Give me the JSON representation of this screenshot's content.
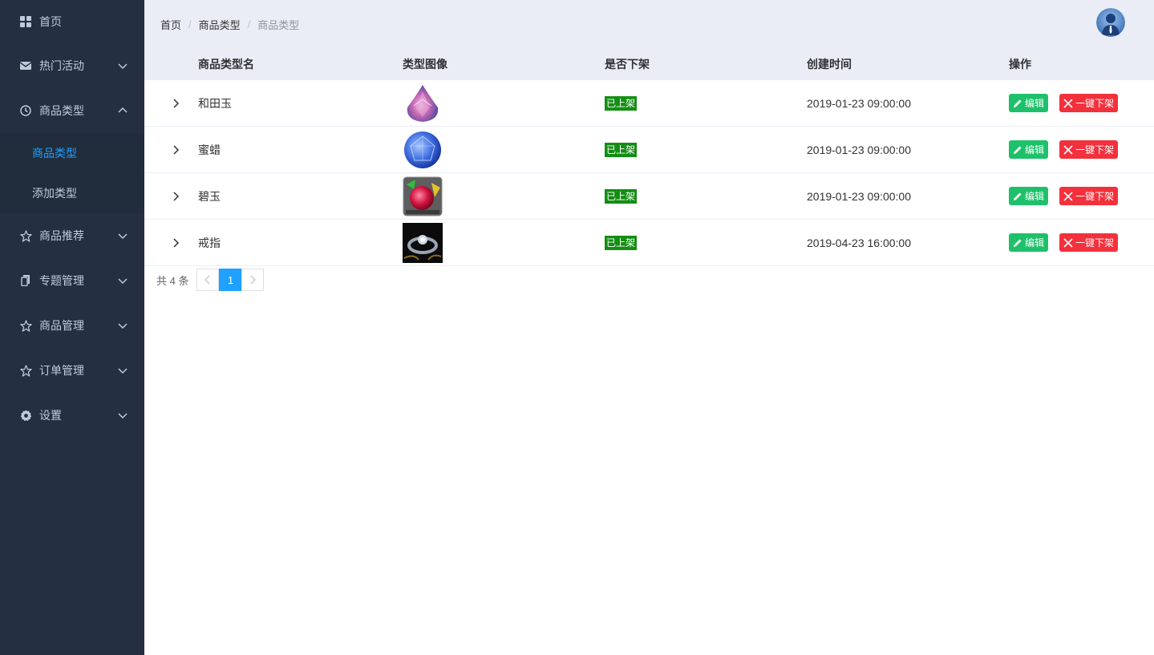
{
  "sidebar": {
    "items": [
      {
        "label": "首页",
        "icon": "grid-icon"
      },
      {
        "label": "热门活动",
        "icon": "mail-icon"
      },
      {
        "label": "商品类型",
        "icon": "clock-icon"
      },
      {
        "label": "商品推荐",
        "icon": "star-icon"
      },
      {
        "label": "专题管理",
        "icon": "document-icon"
      },
      {
        "label": "商品管理",
        "icon": "star-icon"
      },
      {
        "label": "订单管理",
        "icon": "star-icon"
      },
      {
        "label": "设置",
        "icon": "gear-icon"
      }
    ],
    "submenu": [
      {
        "label": "商品类型"
      },
      {
        "label": "添加类型"
      }
    ],
    "active_color": "#20a0ff",
    "bg_color": "#242f42"
  },
  "breadcrumb": [
    "首页",
    "商品类型",
    "商品类型"
  ],
  "table": {
    "headers": {
      "name": "商品类型名",
      "image": "类型图像",
      "status": "是否下架",
      "created": "创建时间",
      "ops": "操作"
    },
    "rows": [
      {
        "name": "和田玉",
        "status": "已上架",
        "created": "2019-01-23 09:00:00",
        "image": "pink-gem"
      },
      {
        "name": "蜜蜡",
        "status": "已上架",
        "created": "2019-01-23 09:00:00",
        "image": "blue-gem"
      },
      {
        "name": "碧玉",
        "status": "已上架",
        "created": "2019-01-23 09:00:00",
        "image": "red-gem"
      },
      {
        "name": "戒指",
        "status": "已上架",
        "created": "2019-04-23 16:00:00",
        "image": "ring"
      }
    ],
    "edit_label": "编辑",
    "off_label": "一键下架"
  },
  "pagination": {
    "total": "共 4 条",
    "current": "1"
  }
}
